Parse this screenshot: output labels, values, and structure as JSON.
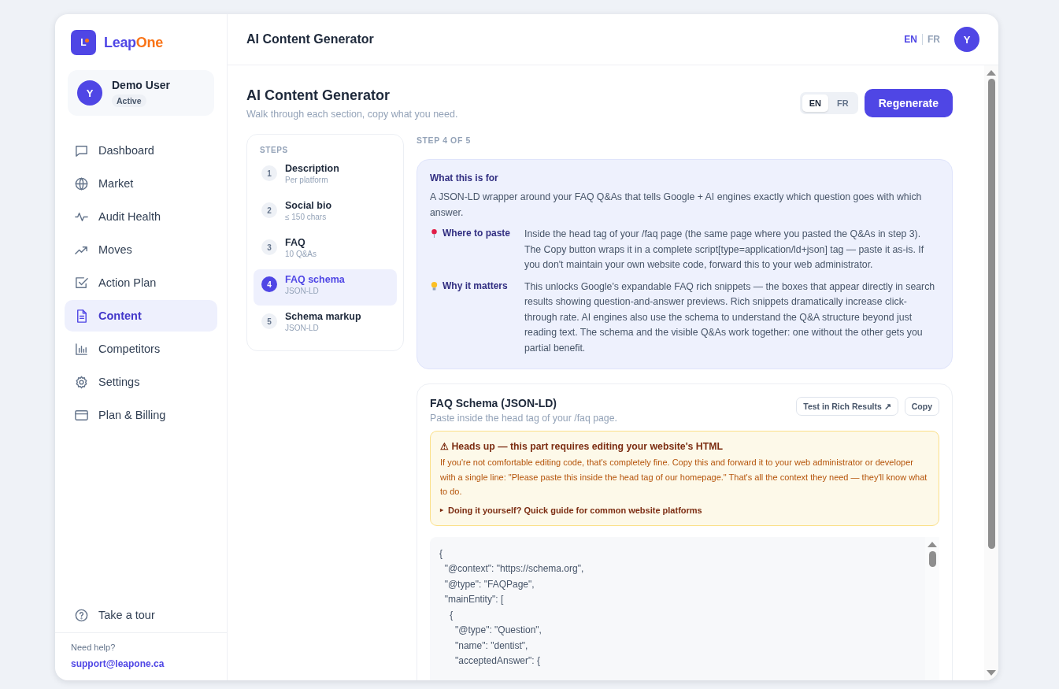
{
  "brand": {
    "logo_letter": "L",
    "parts": [
      {
        "text": "Leap",
        "color": "#4f46e5"
      },
      {
        "text": "One",
        "color": "#f97316"
      }
    ]
  },
  "user": {
    "initial": "Y",
    "name": "Demo User",
    "status": "Active"
  },
  "sidebar": {
    "items": [
      {
        "label": "Dashboard",
        "selected": false
      },
      {
        "label": "Market",
        "selected": false
      },
      {
        "label": "Audit Health",
        "selected": false
      },
      {
        "label": "Moves",
        "selected": false
      },
      {
        "label": "Action Plan",
        "selected": false
      },
      {
        "label": "Content",
        "selected": true
      },
      {
        "label": "Competitors",
        "selected": false
      },
      {
        "label": "Settings",
        "selected": false
      },
      {
        "label": "Plan & Billing",
        "selected": false
      }
    ],
    "tour": "Take a tour",
    "help_label": "Need help?",
    "help_email": "support@leapone.ca"
  },
  "header": {
    "title": "AI Content Generator",
    "languages": [
      {
        "label": "EN",
        "selected": true
      },
      {
        "label": "FR",
        "selected": false
      }
    ],
    "avatar_initial": "Y"
  },
  "page": {
    "title": "AI Content Generator",
    "subtitle": "Walk through each section, copy what you need.",
    "languages": [
      {
        "label": "EN",
        "selected": true
      },
      {
        "label": "FR",
        "selected": false
      }
    ],
    "regenerate": "Regenerate"
  },
  "steps": {
    "heading": "STEPS",
    "items": [
      {
        "number": "1",
        "title": "Description",
        "subtitle": "Per platform",
        "selected": false
      },
      {
        "number": "2",
        "title": "Social bio",
        "subtitle": "≤ 150 chars",
        "selected": false
      },
      {
        "number": "3",
        "title": "FAQ",
        "subtitle": "10 Q&As",
        "selected": false
      },
      {
        "number": "4",
        "title": "FAQ schema",
        "subtitle": "JSON-LD",
        "selected": true
      },
      {
        "number": "5",
        "title": "Schema markup",
        "subtitle": "JSON-LD",
        "selected": false
      }
    ]
  },
  "step_counter": "STEP 4 OF 5",
  "info": {
    "title": "What this is for",
    "text": "A JSON-LD wrapper around your FAQ Q&As that tells Google + AI engines exactly which question goes with which answer.",
    "rows": [
      {
        "label": "Where to paste",
        "text": "Inside the head tag of your /faq page (the same page where you pasted the Q&As in step 3). The Copy button wraps it in a complete script[type=application/ld+json] tag — paste it as-is. If you don't maintain your own website code, forward this to your web administrator."
      },
      {
        "label": "Why it matters",
        "text": "This unlocks Google's expandable FAQ rich snippets — the boxes that appear directly in search results showing question-and-answer previews. Rich snippets dramatically increase click-through rate. AI engines also use the schema to understand the Q&A structure beyond just reading text. The schema and the visible Q&As work together: one without the other gets you partial benefit."
      }
    ]
  },
  "schema": {
    "title": "FAQ Schema (JSON-LD)",
    "subtitle": "Paste inside the head tag of your /faq page.",
    "test_button": "Test in Rich Results ↗",
    "copy_button": "Copy",
    "warning": {
      "title": "⚠ Heads up — this part requires editing your website's HTML",
      "text": "If you're not comfortable editing code, that's completely fine. Copy this and forward it to your web administrator or developer with a single line: \"Please paste this inside the head tag of our homepage.\" That's all the context they need — they'll know what to do.",
      "guide_marker": "▸",
      "guide": "Doing it yourself? Quick guide for common website platforms"
    },
    "code": [
      "{",
      "  \"@context\": \"https://schema.org\",",
      "  \"@type\": \"FAQPage\",",
      "  \"mainEntity\": [",
      "    {",
      "      \"@type\": \"Question\",",
      "      \"name\": \"dentist\",",
      "      \"acceptedAnswer\": {"
    ]
  }
}
